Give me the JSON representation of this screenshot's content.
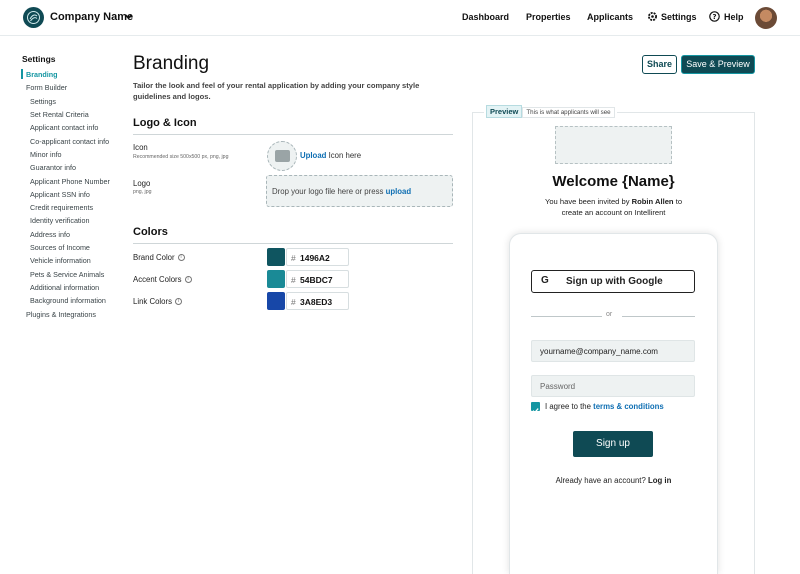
{
  "header": {
    "company_name": "Company Name",
    "nav": [
      "Dashboard",
      "Properties",
      "Applicants",
      "Settings",
      "Help"
    ]
  },
  "sidebar": {
    "title": "Settings",
    "items": [
      "Branding",
      "Form Builder",
      "Settings",
      "Set Rental Criteria",
      "Applicant contact info",
      "Co-applicant contact info",
      "Minor info",
      "Guarantor info",
      "Applicant Phone Number",
      "Applicant SSN info",
      "Credit requirements",
      "Identity verification",
      "Address info",
      "Sources of Income",
      "Vehicle information",
      "Pets & Service Animals",
      "Additional information",
      "Background information",
      "Plugins & Integrations"
    ],
    "active": "Branding"
  },
  "main": {
    "title": "Branding",
    "subtitle": "Tailor the look and feel of your rental application by adding your company style guidelines and logos.",
    "logo_section": {
      "heading": "Logo & Icon",
      "icon_label": "Icon",
      "icon_hint": "Recommended size 500x500 px, png, jpg",
      "icon_upload_link": "Upload",
      "icon_upload_text": "Icon here",
      "logo_label": "Logo",
      "logo_hint": "png, jpg",
      "logo_drop_text": "Drop your logo file here or press",
      "logo_upload_link": "upload"
    },
    "colors_section": {
      "heading": "Colors",
      "hash": "#",
      "rows": [
        {
          "label": "Brand Color",
          "hex": "1496A2",
          "color": "#1496A2",
          "swatch": "#0f5560"
        },
        {
          "label": "Accent Colors",
          "hex": "54BDC7",
          "color": "#54BDC7",
          "swatch": "#1a8a96"
        },
        {
          "label": "Link Colors",
          "hex": "3A8ED3",
          "color": "#3A8ED3",
          "swatch": "#1747a8"
        }
      ]
    }
  },
  "actions": {
    "share": "Share",
    "save_preview": "Save & Preview"
  },
  "preview": {
    "tag": "Preview",
    "tag_note": "This is what applicants will see",
    "welcome": "Welcome {Name}",
    "invited_prefix": "You have been invited by",
    "invited_name": "Robin Allen",
    "invited_suffix": "to",
    "invited_line2": "create an account on Intellirent",
    "google_button": "Sign up with Google",
    "or": "or",
    "email_value": "yourname@company_name.com",
    "password_placeholder": "Password",
    "agree_prefix": "I agree to the",
    "agree_link": "terms & conditions",
    "signup_button": "Sign up",
    "already_text": "Already have an account?",
    "login_link": "Log in"
  }
}
